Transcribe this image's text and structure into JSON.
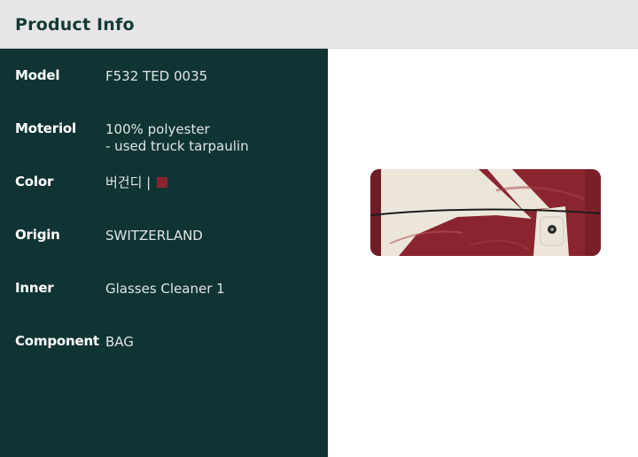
{
  "header": {
    "title": "Product Info"
  },
  "specs": {
    "model": {
      "label": "Model",
      "value": "F532 TED 0035"
    },
    "material": {
      "label": "Moteriol",
      "line1": "100% polyester",
      "line2": "- used truck tarpaulin"
    },
    "color": {
      "label": "Color",
      "value": "버건디 |",
      "swatch": "#8a2530"
    },
    "origin": {
      "label": "Origin",
      "value": "SWITZERLAND"
    },
    "inner": {
      "label": "Inner",
      "value": "Glasses Cleaner 1"
    },
    "component": {
      "label": "Component",
      "value": "BAG"
    }
  },
  "product_image": {
    "subject": "burgundy-and-cream-tarpaulin-glasses-case",
    "colors": {
      "burgundy": "#8a2530",
      "cream": "#ece6da",
      "strap": "#1c1c1c"
    }
  }
}
